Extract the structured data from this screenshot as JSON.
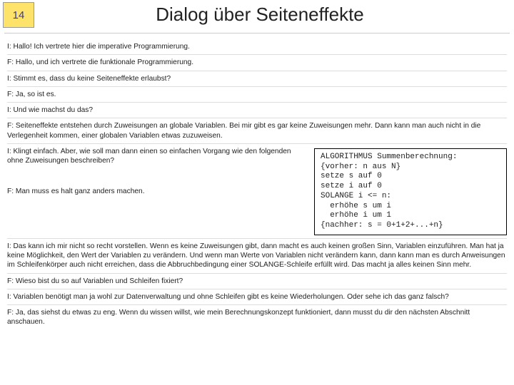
{
  "slide_number": "14",
  "title": "Dialog über Seiteneffekte",
  "paragraphs": {
    "p1": "I: Hallo! Ich vertrete hier die imperative Programmierung.",
    "p2": "F: Hallo, und ich vertrete die funktionale Programmierung.",
    "p3": "I: Stimmt es, dass du keine Seiteneffekte erlaubst?",
    "p4": "F: Ja, so ist es.",
    "p5": "I: Und wie machst du das?",
    "p6": "F: Seiteneffekte entstehen durch Zuweisungen an globale Variablen. Bei mir gibt es gar keine Zuweisungen mehr. Dann kann man auch nicht in die Verlegenheit kommen, einer globalen Variablen etwas zuzuweisen.",
    "p7": "I: Klingt einfach. Aber, wie soll man dann einen so einfachen Vorgang wie den folgenden ohne Zuweisungen beschreiben?",
    "p8": "F: Man muss es halt ganz anders machen.",
    "p9": "I: Das kann ich mir nicht so recht vorstellen. Wenn es keine Zuweisungen gibt, dann macht es auch keinen großen Sinn, Variablen einzuführen. Man hat ja keine Möglichkeit, den Wert der Variablen zu verändern. Und wenn man Werte von Variablen nicht verändern kann, dann kann man es durch Anweisungen im Schleifenkörper auch nicht erreichen, dass die Abbruchbedingung einer SOLANGE-Schleife erfüllt wird. Das macht ja alles keinen Sinn mehr.",
    "p10": "F: Wieso bist du so auf Variablen und Schleifen fixiert?",
    "p11": "I: Variablen benötigt man ja wohl zur Datenverwaltung und ohne Schleifen gibt es keine Wiederholungen. Oder sehe ich das ganz falsch?",
    "p12": "F: Ja, das siehst du etwas zu eng. Wenn du wissen willst, wie mein Berechnungskonzept funktioniert, dann musst du dir den nächsten Abschnitt anschauen."
  },
  "algorithm": "ALGORITHMUS Summenberechnung:\n{vorher: n aus N}\nsetze s auf 0\nsetze i auf 0\nSOLANGE i <= n:\n  erhöhe s um i\n  erhöhe i um 1\n{nachher: s = 0+1+2+...+n}"
}
